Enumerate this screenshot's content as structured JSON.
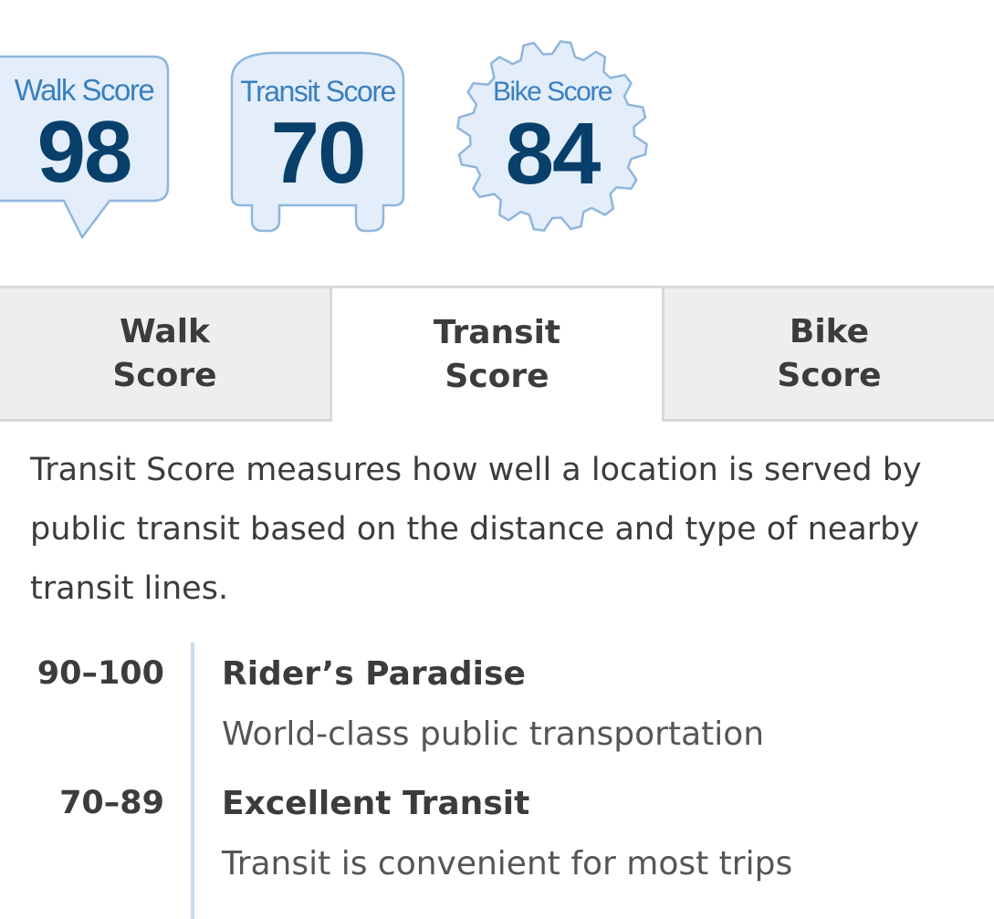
{
  "badges": {
    "walk": {
      "label": "Walk Score",
      "value": "98"
    },
    "transit": {
      "label": "Transit Score",
      "value": "70"
    },
    "bike": {
      "label": "Bike Score",
      "value": "84"
    }
  },
  "tabs": [
    {
      "label": "Walk\nScore",
      "active": false
    },
    {
      "label": "Transit\nScore",
      "active": true
    },
    {
      "label": "Bike\nScore",
      "active": false
    }
  ],
  "description": "Transit Score measures how well a location is served by public transit based on the distance and type of nearby transit lines.",
  "scale": [
    {
      "range": "90–100",
      "title": "Rider’s Paradise",
      "desc": "World-class public transportation"
    },
    {
      "range": "70–89",
      "title": "Excellent Transit",
      "desc": "Transit is convenient for most trips"
    }
  ],
  "colors": {
    "badge_fill": "#e3eefa",
    "badge_stroke": "#8fb6dc",
    "badge_label": "#3a7fc0",
    "badge_value": "#08406b",
    "tab_inactive": "#eeeeee",
    "rule": "#c7dcee"
  }
}
